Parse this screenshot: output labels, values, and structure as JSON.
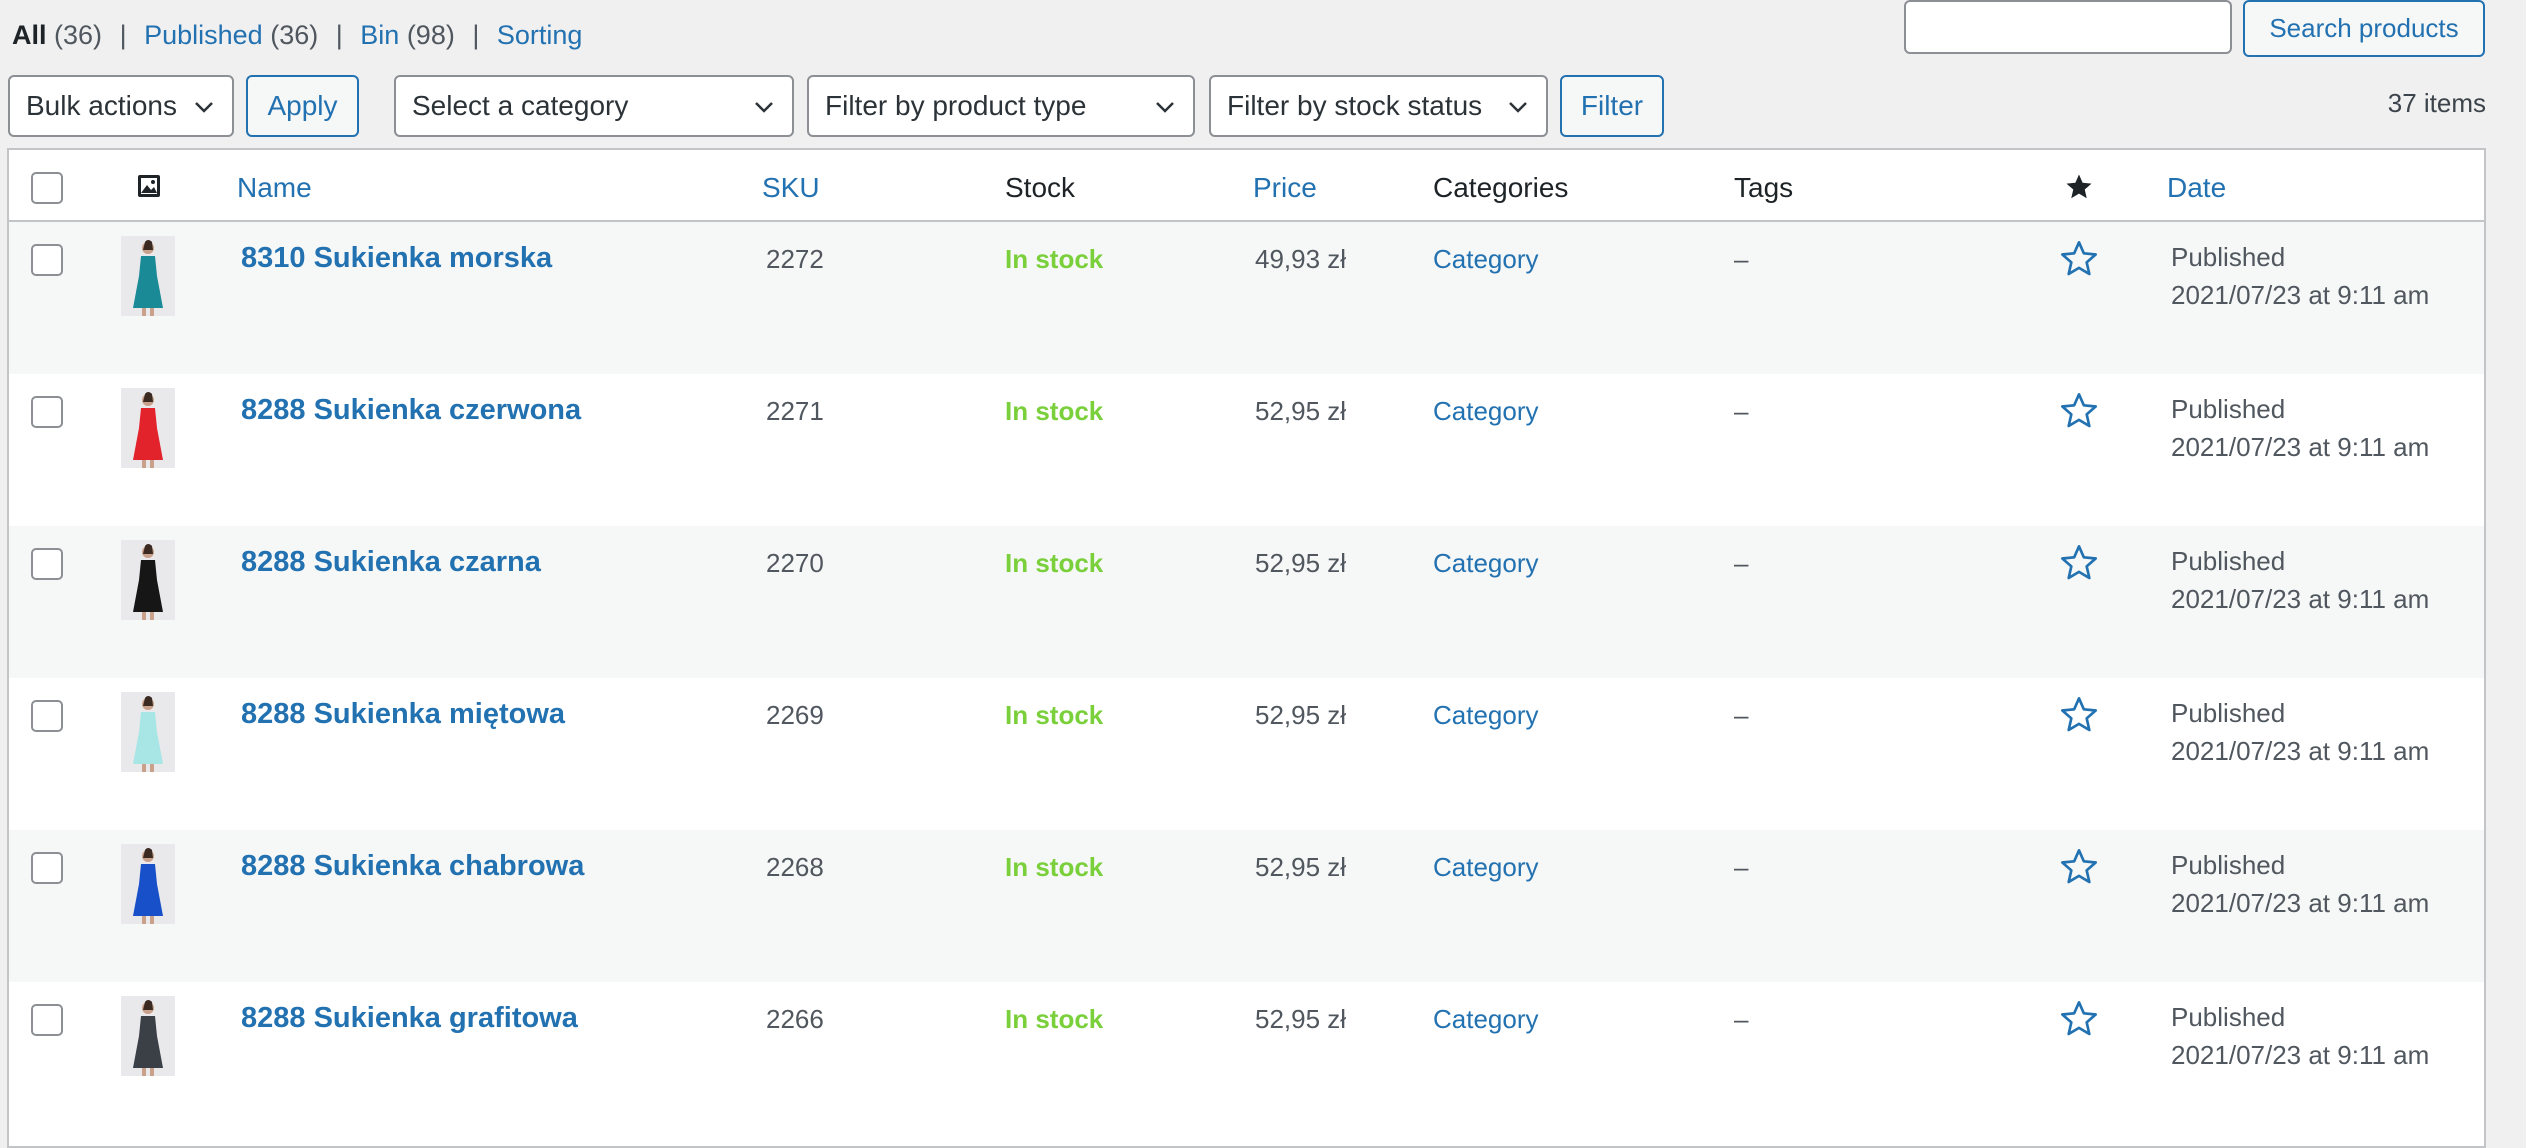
{
  "status_links": {
    "all_label": "All",
    "all_count": "(36)",
    "published_label": "Published",
    "published_count": "(36)",
    "bin_label": "Bin",
    "bin_count": "(98)",
    "sorting_label": "Sorting",
    "separator": "|"
  },
  "search": {
    "value": "",
    "button_label": "Search products"
  },
  "filters": {
    "bulk_actions": "Bulk actions",
    "apply_label": "Apply",
    "category": "Select a category",
    "product_type": "Filter by product type",
    "stock_status": "Filter by stock status",
    "filter_label": "Filter"
  },
  "item_count": "37 items",
  "columns": {
    "name": "Name",
    "sku": "SKU",
    "stock": "Stock",
    "price": "Price",
    "categories": "Categories",
    "tags": "Tags",
    "date": "Date"
  },
  "colors": {
    "link": "#2271b1",
    "in_stock": "#7ad03a"
  },
  "products": [
    {
      "name": "8310 Sukienka morska",
      "sku": "2272",
      "stock": "In stock",
      "price": "49,93 zł",
      "category": "Category",
      "tags": "–",
      "status": "Published",
      "date": "2021/07/23 at 9:11 am",
      "dress_color": "#1a8a96"
    },
    {
      "name": "8288 Sukienka czerwona",
      "sku": "2271",
      "stock": "In stock",
      "price": "52,95 zł",
      "category": "Category",
      "tags": "–",
      "status": "Published",
      "date": "2021/07/23 at 9:11 am",
      "dress_color": "#e3232c"
    },
    {
      "name": "8288 Sukienka czarna",
      "sku": "2270",
      "stock": "In stock",
      "price": "52,95 zł",
      "category": "Category",
      "tags": "–",
      "status": "Published",
      "date": "2021/07/23 at 9:11 am",
      "dress_color": "#161616"
    },
    {
      "name": "8288 Sukienka miętowa",
      "sku": "2269",
      "stock": "In stock",
      "price": "52,95 zł",
      "category": "Category",
      "tags": "–",
      "status": "Published",
      "date": "2021/07/23 at 9:11 am",
      "dress_color": "#a8e6e6"
    },
    {
      "name": "8288 Sukienka chabrowa",
      "sku": "2268",
      "stock": "In stock",
      "price": "52,95 zł",
      "category": "Category",
      "tags": "–",
      "status": "Published",
      "date": "2021/07/23 at 9:11 am",
      "dress_color": "#1750c9"
    },
    {
      "name": "8288 Sukienka grafitowa",
      "sku": "2266",
      "stock": "In stock",
      "price": "52,95 zł",
      "category": "Category",
      "tags": "–",
      "status": "Published",
      "date": "2021/07/23 at 9:11 am",
      "dress_color": "#3b3f46"
    }
  ]
}
